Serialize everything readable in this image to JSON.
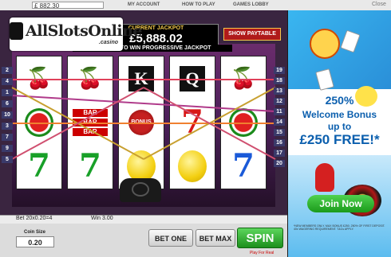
{
  "topbar": {
    "balance": "£ 882.30",
    "nav": [
      "MY ACCOUNT",
      "HOW TO PLAY",
      "GAMES LOBBY"
    ],
    "close": "Close"
  },
  "logo": {
    "main": "AllSlotsOnline",
    "sub": ".casino"
  },
  "jackpot": {
    "title": "CURRENT JACKPOT",
    "amount": "£5,888.02",
    "subtitle": "BET MAX TO WIN PROGRESSIVE JACKPOT"
  },
  "paytable_label": "SHOW PAYTABLE",
  "reels": [
    [
      "cherry",
      "watermelon",
      "seven"
    ],
    [
      "cherry",
      "bar",
      "seven"
    ],
    [
      "K",
      "bell",
      "lemon"
    ],
    [
      "Q",
      "seven",
      "lemon"
    ],
    [
      "cherry",
      "watermelon",
      "seven"
    ]
  ],
  "bell_label": "BONUS",
  "line_numbers_left": [
    "2",
    "4",
    "1",
    "6",
    "10",
    "3",
    "7",
    "9",
    "5"
  ],
  "line_numbers_right": [
    "19",
    "18",
    "13",
    "12",
    "11",
    "14",
    "15",
    "16",
    "17",
    "20"
  ],
  "info": {
    "bet": "Bet 20x0.20=4",
    "win": "Win 3.00"
  },
  "coin": {
    "label": "Coin Size",
    "value": "0.20"
  },
  "buttons": {
    "bet_one": "BET ONE",
    "bet_max": "BET MAX",
    "spin": "SPIN"
  },
  "play_for_real": "Play For Real",
  "promo": {
    "line1": "250%",
    "line2": "Welcome Bonus",
    "line3": "up to",
    "line4": "£250 FREE!*",
    "join": "Join Now",
    "fineprint": "*NEW MEMBERS ONLY. MAX BONUS £250. 250% OF FIRST DEPOSIT. 40x WAGERING REQUIREMENT. T&Cs APPLY."
  },
  "colors": {
    "accent": "#0b5fae",
    "spin": "#1c8f1c",
    "jackpot_title": "#f2c94c"
  }
}
